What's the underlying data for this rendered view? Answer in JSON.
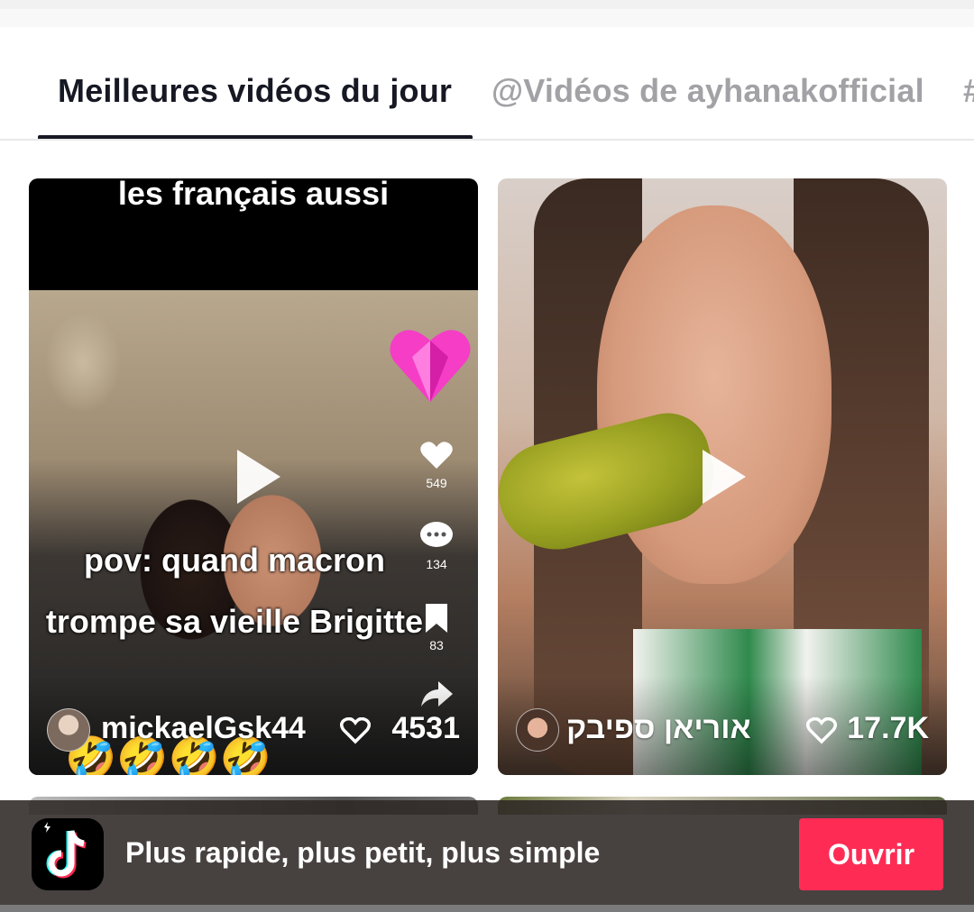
{
  "tabs": [
    {
      "label": "Meilleures vidéos du jour",
      "active": true
    },
    {
      "label": "@Vidéos de ayhanakofficial",
      "active": false
    },
    {
      "label": "#",
      "active": false
    }
  ],
  "videos": [
    {
      "caption_top": "les français aussi",
      "caption_main": "pov: quand macron trompe sa vieille Brigitte",
      "side_counts": {
        "likes": "549",
        "comments": "134",
        "saves": "83"
      },
      "emoji_row": "🤣🤣🤣🤣",
      "username": "mickaelGsk44",
      "like_count": "4531"
    },
    {
      "username": "אוריאן ספיבק",
      "like_count": "17.7K"
    }
  ],
  "banner": {
    "text": "Plus rapide, plus petit, plus simple",
    "button_label": "Ouvrir"
  },
  "icons": [
    "play-icon",
    "heart-icon",
    "comment-icon",
    "bookmark-icon",
    "share-icon",
    "tiktok-logo-icon",
    "heart-sticker-icon"
  ],
  "colors": {
    "accent": "#fe2c55",
    "text_primary": "#161823",
    "text_muted": "#a2a2a6"
  }
}
